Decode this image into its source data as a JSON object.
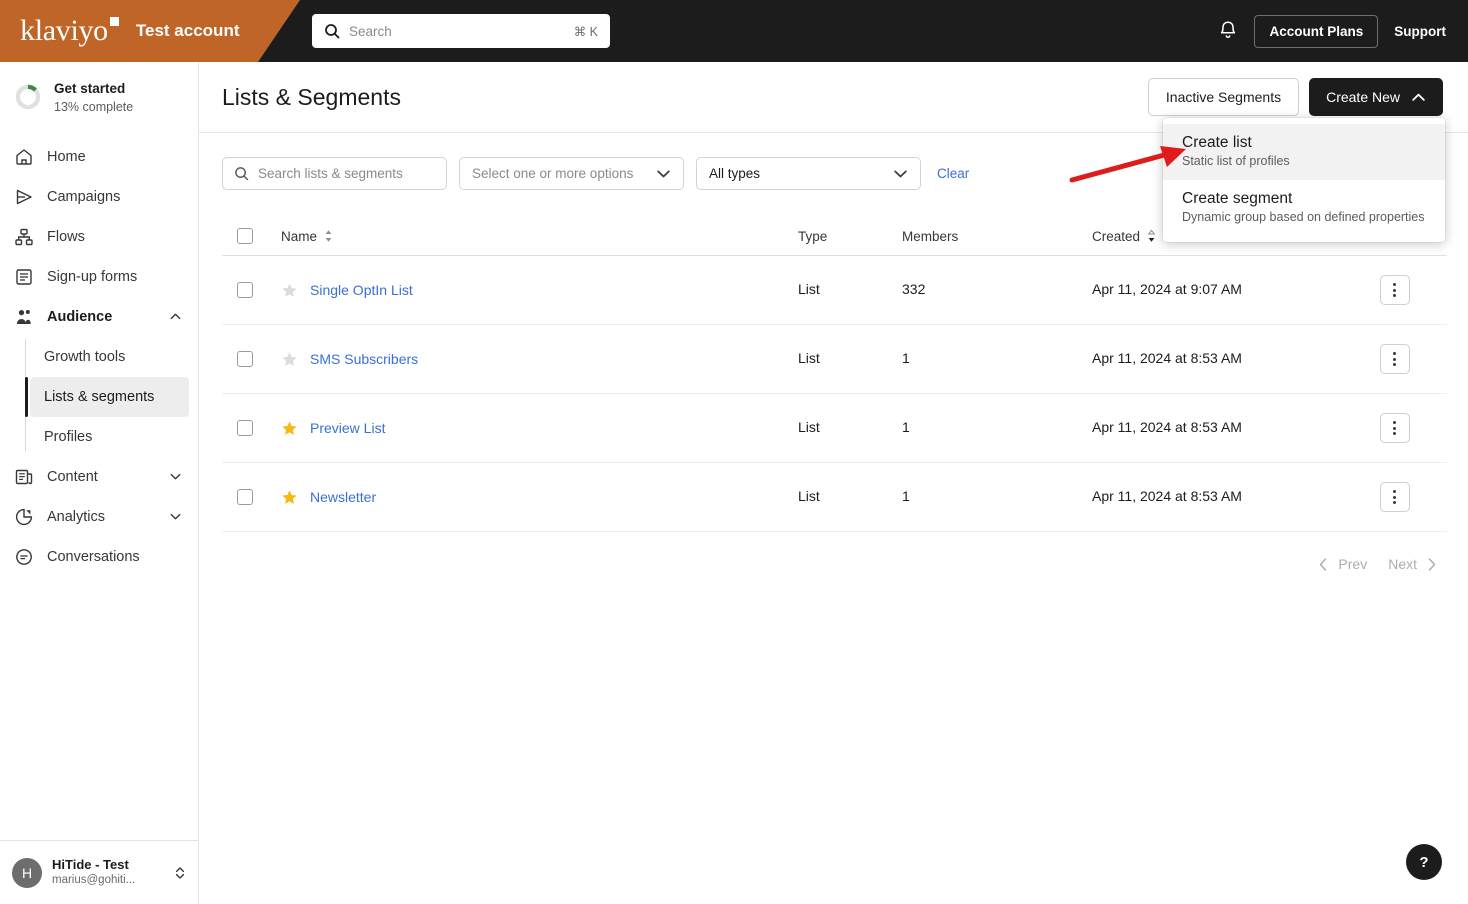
{
  "topbar": {
    "logo_text": "klaviyo",
    "account_name": "Test account",
    "search_placeholder": "Search",
    "search_value": "",
    "search_shortcut": "⌘ K",
    "notifications_icon": "bell-icon",
    "account_plans_label": "Account Plans",
    "support_label": "Support",
    "background_color": "#1c1c1c",
    "brand_color": "#bf6528"
  },
  "sidebar": {
    "get_started": {
      "title": "Get started",
      "subtitle": "13% complete",
      "percent": 13,
      "ring_color": "#3f8a3f",
      "track_color": "#e0e0e0"
    },
    "items": [
      {
        "label": "Home",
        "icon": "home-icon",
        "expandable": false
      },
      {
        "label": "Campaigns",
        "icon": "send-icon",
        "expandable": false
      },
      {
        "label": "Flows",
        "icon": "flows-icon",
        "expandable": false
      },
      {
        "label": "Sign-up forms",
        "icon": "form-icon",
        "expandable": false
      },
      {
        "label": "Audience",
        "icon": "audience-icon",
        "expandable": true,
        "expanded": true
      },
      {
        "label": "Content",
        "icon": "content-icon",
        "expandable": true,
        "expanded": false
      },
      {
        "label": "Analytics",
        "icon": "analytics-icon",
        "expandable": true,
        "expanded": false
      },
      {
        "label": "Conversations",
        "icon": "conversations-icon",
        "expandable": false
      }
    ],
    "audience_children": [
      {
        "label": "Growth tools",
        "selected": false
      },
      {
        "label": "Lists & segments",
        "selected": true
      },
      {
        "label": "Profiles",
        "selected": false
      }
    ],
    "user": {
      "avatar_initial": "H",
      "name": "HiTide - Test",
      "email": "marius@gohiti...",
      "switcher_icon": "chevron-updown-icon"
    }
  },
  "page": {
    "title": "Lists & Segments",
    "inactive_segments_label": "Inactive Segments",
    "create_new_label": "Create New",
    "create_new_chevron": "chevron-up-icon"
  },
  "dropdown": {
    "open": true,
    "items": [
      {
        "title": "Create list",
        "subtitle": "Static list of profiles",
        "highlighted": true
      },
      {
        "title": "Create segment",
        "subtitle": "Dynamic group based on defined properties",
        "highlighted": false
      }
    ]
  },
  "annotation": {
    "type": "arrow",
    "color": "#e01b1b",
    "points_to": "Create list"
  },
  "filters": {
    "search_placeholder": "Search lists & segments",
    "search_value": "",
    "search_icon": "search-icon",
    "multi_select_value": "Select one or more options",
    "types_value": "All types",
    "clear_label": "Clear",
    "chevron_icon": "chevron-down-icon"
  },
  "table": {
    "columns": [
      {
        "label": "",
        "key": "checkbox"
      },
      {
        "label": "Name",
        "key": "name",
        "sortable": true,
        "sort_state": "none"
      },
      {
        "label": "Type",
        "key": "type",
        "sortable": false
      },
      {
        "label": "Members",
        "key": "members",
        "sortable": false
      },
      {
        "label": "Created",
        "key": "created",
        "sortable": true,
        "sort_state": "desc"
      },
      {
        "label": "",
        "key": "actions"
      }
    ],
    "header_checkbox_checked": false,
    "rows": [
      {
        "checked": false,
        "starred": false,
        "name": "Single OptIn List",
        "type": "List",
        "members": "332",
        "created": "Apr 11, 2024 at 9:07 AM"
      },
      {
        "checked": false,
        "starred": false,
        "name": "SMS Subscribers",
        "type": "List",
        "members": "1",
        "created": "Apr 11, 2024 at 8:53 AM"
      },
      {
        "checked": false,
        "starred": true,
        "name": "Preview List",
        "type": "List",
        "members": "1",
        "created": "Apr 11, 2024 at 8:53 AM"
      },
      {
        "checked": false,
        "starred": true,
        "name": "Newsletter",
        "type": "List",
        "members": "1",
        "created": "Apr 11, 2024 at 8:53 AM"
      }
    ],
    "row_action_icon": "kebab-menu-icon",
    "star_on_color": "#f5b916",
    "star_off_color": "#dcdcdc",
    "link_color": "#3b6fd4"
  },
  "pagination": {
    "prev_label": "Prev",
    "next_label": "Next",
    "prev_enabled": false,
    "next_enabled": false
  },
  "help": {
    "label": "?"
  }
}
